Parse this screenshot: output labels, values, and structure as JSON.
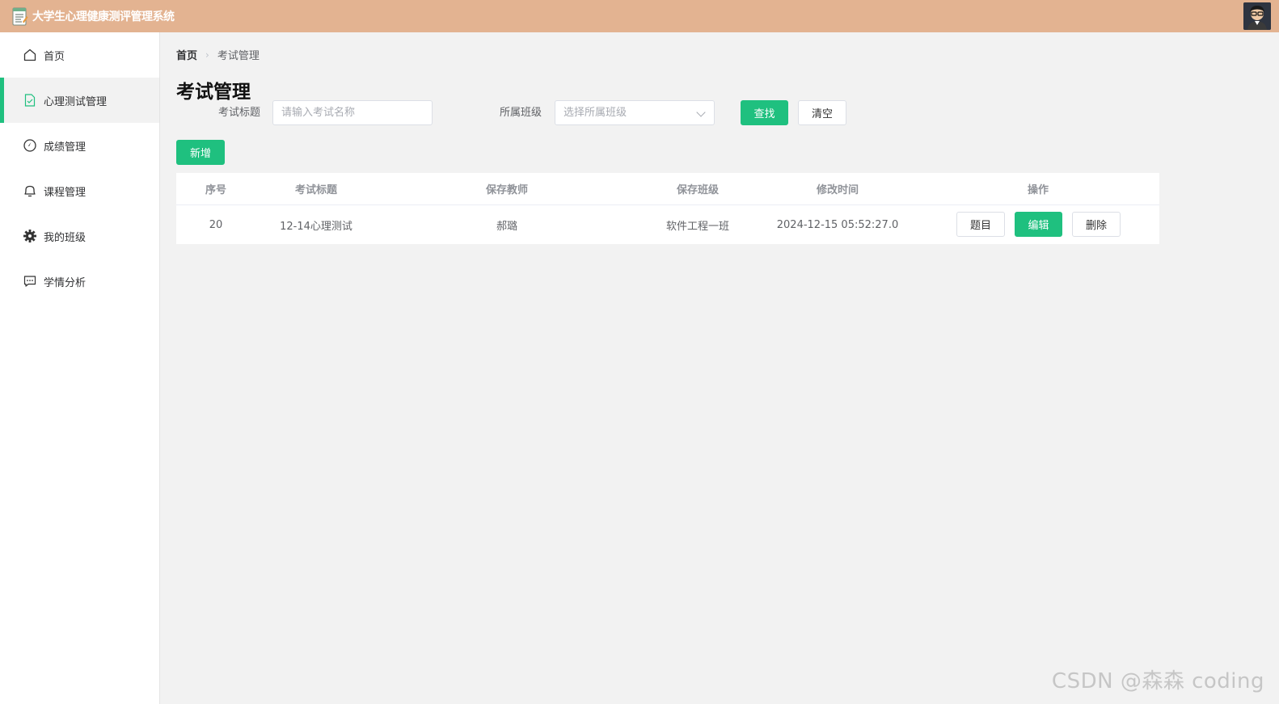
{
  "header": {
    "app_title": "大学生心理健康测评管理系统"
  },
  "sidebar": {
    "items": [
      {
        "label": "首页",
        "icon": "home-icon"
      },
      {
        "label": "心理测试管理",
        "icon": "document-check-icon"
      },
      {
        "label": "成绩管理",
        "icon": "compass-icon"
      },
      {
        "label": "课程管理",
        "icon": "bell-icon"
      },
      {
        "label": "我的班级",
        "icon": "gear-icon"
      },
      {
        "label": "学情分析",
        "icon": "chat-icon"
      }
    ],
    "active_index": 1
  },
  "breadcrumb": {
    "home": "首页",
    "current": "考试管理"
  },
  "page": {
    "title": "考试管理"
  },
  "filters": {
    "title_label": "考试标题",
    "title_placeholder": "请输入考试名称",
    "title_value": "",
    "class_label": "所属班级",
    "class_placeholder": "选择所属班级",
    "search_button": "查找",
    "clear_button": "清空"
  },
  "toolbar": {
    "add_button": "新增"
  },
  "table": {
    "columns": [
      "序号",
      "考试标题",
      "保存教师",
      "保存班级",
      "修改时间",
      "操作"
    ],
    "rows": [
      {
        "id": "20",
        "title": "12-14心理测试",
        "teacher": "郝璐",
        "class": "软件工程一班",
        "modified": "2024-12-15 05:52:27.0",
        "actions": {
          "questions": "题目",
          "edit": "编辑",
          "delete": "删除"
        }
      }
    ]
  },
  "watermark": "CSDN @森森 coding",
  "colors": {
    "header_bg": "#e3b391",
    "primary": "#1fc07f",
    "page_bg": "#f2f2f2"
  }
}
